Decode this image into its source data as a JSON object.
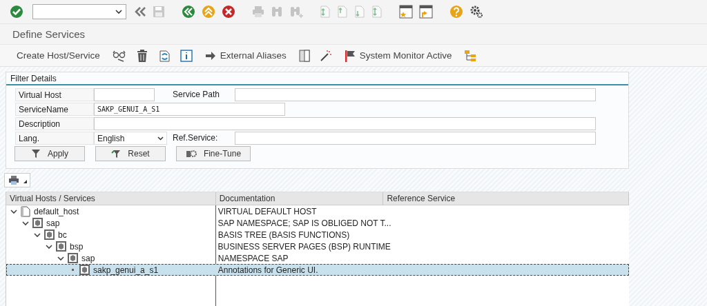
{
  "window": {
    "title": "Define Services"
  },
  "app_toolbar": [
    "Create Host/Service",
    "External Aliases",
    "System Monitor Active"
  ],
  "filter": {
    "title": "Filter Details",
    "rows": [
      [
        {
          "kind": "label",
          "text": "Virtual Host"
        },
        {
          "kind": "input"
        },
        {
          "kind": "label",
          "text": "Service Path"
        },
        {
          "kind": "input"
        }
      ],
      [
        {
          "kind": "label",
          "text": "ServiceName"
        },
        {
          "kind": "input",
          "value": "SAKP_GENUI_A_S1"
        }
      ],
      [
        {
          "kind": "label",
          "text": "Description"
        },
        {
          "kind": "input"
        }
      ],
      [
        {
          "kind": "label",
          "text": "Lang."
        },
        {
          "kind": "dropdown",
          "value": "English"
        },
        {
          "kind": "label",
          "text": "Ref.Service:"
        },
        {
          "kind": "input"
        }
      ]
    ],
    "buttons": [
      "Apply",
      "Reset",
      "Fine-Tune"
    ]
  },
  "tree": {
    "columns": [
      "Virtual Hosts / Services",
      "Documentation",
      "Reference Service"
    ],
    "nodes": [
      {
        "kind": "host",
        "name": "default_host",
        "documentation": "VIRTUAL DEFAULT HOST",
        "expanded": true,
        "selected": false,
        "children": [
          {
            "kind": "service",
            "name": "sap",
            "documentation": "SAP NAMESPACE; SAP IS OBLIGED NOT T...",
            "expanded": true,
            "selected": false,
            "children": [
              {
                "kind": "service",
                "name": "bc",
                "documentation": "BASIS TREE (BASIS FUNCTIONS)",
                "expanded": true,
                "selected": false,
                "children": [
                  {
                    "kind": "service",
                    "name": "bsp",
                    "documentation": "BUSINESS SERVER PAGES (BSP) RUNTIME",
                    "expanded": true,
                    "selected": false,
                    "children": [
                      {
                        "kind": "service",
                        "name": "sap",
                        "documentation": "NAMESPACE SAP",
                        "expanded": true,
                        "selected": false,
                        "children": [
                          {
                            "kind": "service",
                            "name": "sakp_genui_a_s1",
                            "documentation": "Annotations for Generic UI.",
                            "selected": true
                          }
                        ]
                      }
                    ]
                  }
                ]
              }
            ]
          }
        ]
      }
    ]
  }
}
